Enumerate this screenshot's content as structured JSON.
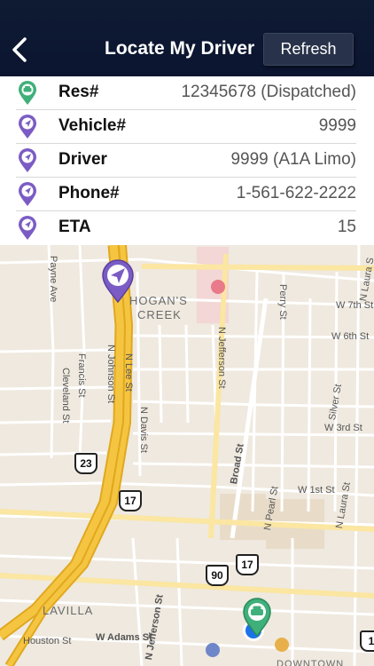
{
  "header": {
    "title": "Locate My Driver",
    "refresh_label": "Refresh",
    "back_icon": "chevron-left-icon"
  },
  "info": [
    {
      "label": "Res#",
      "value": "12345678 (Dispatched)",
      "icon": "green-car-pin-icon"
    },
    {
      "label": "Vehicle#",
      "value": "9999",
      "icon": "purple-navigation-pin-icon"
    },
    {
      "label": "Driver",
      "value": "9999 (A1A Limo)",
      "icon": "purple-navigation-pin-icon"
    },
    {
      "label": "Phone#",
      "value": "1-561-622-2222",
      "icon": "purple-navigation-pin-icon"
    },
    {
      "label": "ETA",
      "value": "15",
      "icon": "purple-navigation-pin-icon"
    }
  ],
  "map": {
    "area_labels": {
      "hogans_1": "HOGAN'S",
      "hogans_2": "CREEK",
      "lavilla": "LAVILLA",
      "downtown": "DOWNTOWN"
    },
    "streets": {
      "payne": "Payne Ave",
      "perry": "Perry St",
      "laura_n": "N Laura S",
      "w7th": "W 7th St",
      "w6th": "W 6th St",
      "francis": "Francis St",
      "cleveland": "Cleveland St",
      "johnson": "N Johnson St",
      "lee": "N Lee St",
      "jefferson_top": "N Jefferson St",
      "silver": "Silver St",
      "w3rd": "W 3rd St",
      "davis": "N Davis St",
      "broad": "Broad St",
      "w1st": "W 1st St",
      "pearl": "N Pearl St",
      "laura_s": "N Laura St",
      "jefferson_bottom": "N Jefferson St",
      "adams": "W Adams St",
      "houston": "Houston St"
    },
    "shields": {
      "us23": "23",
      "us17a": "17",
      "us90": "90",
      "us17b": "17",
      "edge": "1"
    },
    "colors": {
      "land": "#efe9df",
      "highway": "#f5c542",
      "road": "#ffffff",
      "driver_pin": "#7b5cc4",
      "pickup_pin": "#3fb07a"
    }
  }
}
